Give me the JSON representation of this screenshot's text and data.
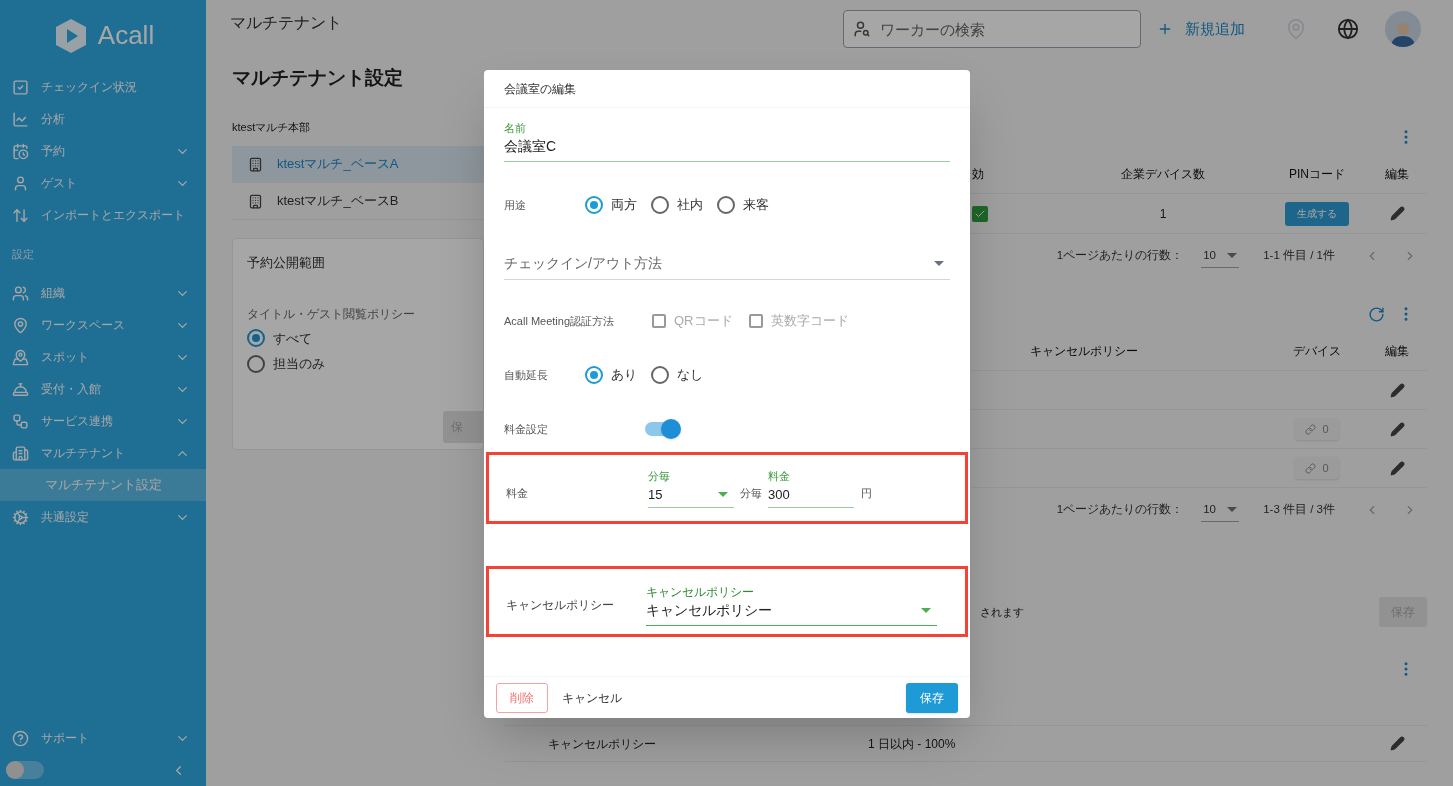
{
  "sidebar": {
    "logo": "Acall",
    "main_items": [
      {
        "label": "チェックイン状況",
        "kind": "link"
      },
      {
        "label": "分析",
        "kind": "link"
      },
      {
        "label": "予約",
        "kind": "group",
        "expanded": false
      },
      {
        "label": "ゲスト",
        "kind": "group",
        "expanded": false
      },
      {
        "label": "インポートとエクスポート",
        "kind": "link"
      }
    ],
    "settings_label": "設定",
    "settings_items": [
      {
        "label": "組織",
        "kind": "group",
        "expanded": false
      },
      {
        "label": "ワークスペース",
        "kind": "group",
        "expanded": false
      },
      {
        "label": "スポット",
        "kind": "group",
        "expanded": false
      },
      {
        "label": "受付・入館",
        "kind": "group",
        "expanded": false
      },
      {
        "label": "サービス連携",
        "kind": "group",
        "expanded": false
      },
      {
        "label": "マルチテナント",
        "kind": "group",
        "expanded": true,
        "children": [
          {
            "label": "マルチテナント設定",
            "selected": true
          }
        ]
      },
      {
        "label": "共通設定",
        "kind": "group",
        "expanded": false
      }
    ],
    "support": {
      "label": "サポート",
      "kind": "group",
      "expanded": false
    },
    "footer_toggle": {
      "on": false
    }
  },
  "header": {
    "title": "マルチテナント",
    "search": {
      "placeholder": "ワーカーの検索"
    },
    "add_button": "新規追加"
  },
  "left": {
    "heading": "マルチテナント設定",
    "org": "ktestマルチ本部",
    "bases": [
      {
        "label": "ktestマルチ_ベースA",
        "selected": true
      },
      {
        "label": "ktestマルチ_ベースB",
        "selected": false
      }
    ],
    "card": {
      "title": "予約公開範囲",
      "policy_label": "タイトル・ゲスト閲覧ポリシー",
      "options": [
        {
          "label": "すべて",
          "selected": true
        },
        {
          "label": "担当のみ",
          "selected": false
        }
      ],
      "save_button": "保"
    }
  },
  "device_table": {
    "columns": [
      "効",
      "企業デバイス数",
      "PINコード",
      "編集"
    ],
    "rows": [
      {
        "enabled": true,
        "count": "1",
        "pin_button": "生成する"
      }
    ],
    "pagination": {
      "rows_label": "1ページあたりの行数：",
      "per_page": "10",
      "range": "1-1 件目 / 1件"
    }
  },
  "room_table": {
    "columns": [
      "キャンセルポリシー",
      "デバイス",
      "編集"
    ],
    "rows": [
      {},
      {
        "devices": "0"
      },
      {
        "devices": "0"
      }
    ],
    "pagination": {
      "rows_label": "1ページあたりの行数：",
      "per_page": "10",
      "range": "1-3 件目 / 3件"
    }
  },
  "policy_note": "されます",
  "policy_save": {
    "label": "保存",
    "disabled": true
  },
  "policy_table": {
    "rows": [
      {
        "name": "キャンセルポリシー",
        "setting": "1 日以内 - 100%"
      }
    ]
  },
  "modal": {
    "title": "会議室の編集",
    "name_field": {
      "label": "名前",
      "value": "会議室C"
    },
    "usage": {
      "label": "用途",
      "options": [
        {
          "label": "両方",
          "selected": true
        },
        {
          "label": "社内",
          "selected": false
        },
        {
          "label": "来客",
          "selected": false
        }
      ]
    },
    "checkin_select": {
      "placeholder": "チェックイン/アウト方法"
    },
    "auth": {
      "label": "Acall Meeting認証方法",
      "options": [
        {
          "label": "QRコード",
          "checked": false,
          "disabled": true
        },
        {
          "label": "英数字コード",
          "checked": false,
          "disabled": true
        }
      ]
    },
    "auto_extend": {
      "label": "自動延長",
      "options": [
        {
          "label": "あり",
          "selected": true
        },
        {
          "label": "なし",
          "selected": false
        }
      ]
    },
    "fee_setting": {
      "label": "料金設定",
      "on": true
    },
    "fee": {
      "label": "料金",
      "highlighted": true,
      "interval": {
        "label": "分毎",
        "value": "15"
      },
      "interval_suffix": "分毎",
      "amount": {
        "label": "料金",
        "value": "300"
      },
      "currency": "円"
    },
    "cancel_policy": {
      "label": "キャンセルポリシー",
      "highlighted": true,
      "select": {
        "label": "キャンセルポリシー",
        "value": "キャンセルポリシー"
      }
    },
    "delete_button": "削除",
    "cancel_button": "キャンセル",
    "save_button": "保存"
  }
}
